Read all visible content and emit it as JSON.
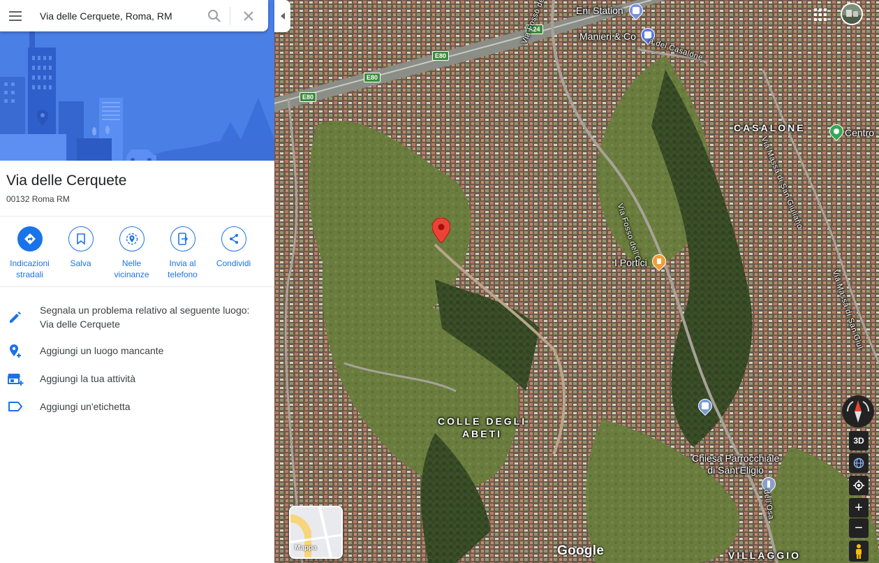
{
  "search": {
    "value": "Via delle Cerquete, Roma, RM"
  },
  "place": {
    "title": "Via delle Cerquete",
    "address": "00132 Roma RM"
  },
  "actions": [
    {
      "label_line1": "Indicazioni",
      "label_line2": "stradali",
      "icon": "directions-icon"
    },
    {
      "label_line1": "Salva",
      "label_line2": "",
      "icon": "bookmark-icon"
    },
    {
      "label_line1": "Nelle",
      "label_line2": "vicinanze",
      "icon": "nearby-icon"
    },
    {
      "label_line1": "Invia al",
      "label_line2": "telefono",
      "icon": "send-to-phone-icon"
    },
    {
      "label_line1": "Condividi",
      "label_line2": "",
      "icon": "share-icon"
    }
  ],
  "links": {
    "report_line1": "Segnala un problema relativo al seguente luogo:",
    "report_line2": "Via delle Cerquete",
    "add_place": "Aggiungi un luogo mancante",
    "add_business": "Aggiungi la tua attività",
    "add_label": "Aggiungi un'etichetta"
  },
  "map": {
    "labels": {
      "eni": "Eni Station",
      "manieri": "Manieri & Co",
      "casalone_road": "a del Casalone",
      "casalone": "CASALONE",
      "centro": "Centro",
      "via_fosso_top": "Via Fosso dell'Osa",
      "via_fosso_mid": "Via Fosso dell'O",
      "via_massa_1": "Via Massa di San Giuliano",
      "via_massa_2": "Via Massa di San Giul",
      "portici": "I Portici",
      "colle_1": "COLLE DEGLI",
      "colle_2": "ABETI",
      "chiesa_1": "Chiesa Parrocchiale",
      "chiesa_2": "di Sant'Eligio",
      "osa_bottom": "dell'Osa",
      "villaggio": "VILLAGGIO",
      "e80_a": "E80",
      "e80_b": "E80",
      "e80_c": "E80",
      "a24": "A24"
    },
    "minimap_label": "Mappa",
    "google_logo": "Google",
    "controls": {
      "view3d": "3D",
      "zoom_in": "+",
      "zoom_out": "−"
    }
  },
  "colors": {
    "accent": "#1a73e8",
    "hero": "#4a7fe6",
    "pin": "#ea4335"
  }
}
